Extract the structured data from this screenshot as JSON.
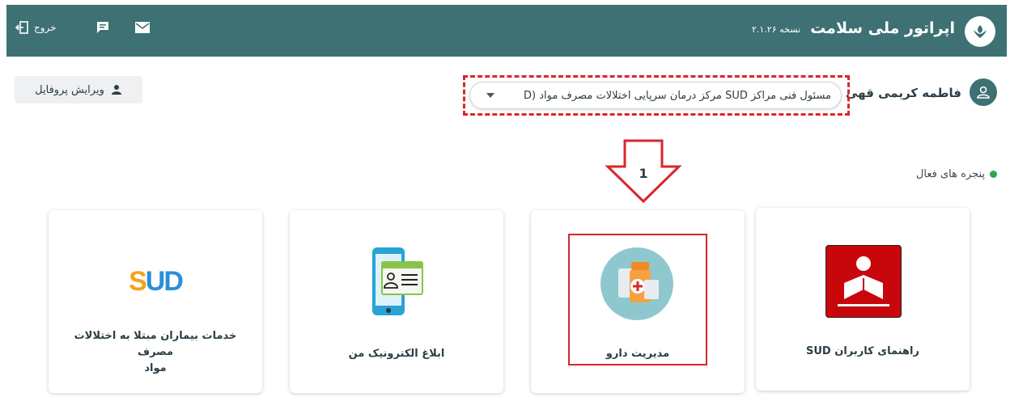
{
  "header": {
    "title": "اپراتور ملی سلامت",
    "version": "نسخه ۲.۱.۲۶",
    "logout_label": "خروج",
    "icons": [
      "brand-logo-icon",
      "message-icon",
      "mail-icon",
      "logout-icon"
    ],
    "bg_color": "#3d7173"
  },
  "user": {
    "name": "فاطمه کریمی قهی",
    "role": "مسئول فنی مراکز SUD مرکز درمان سرپایی اختلالات مصرف مواد (D",
    "edit_profile_label": "ویرایش پروفایل"
  },
  "annotation": {
    "step_number": "1",
    "accent_color": "#d9262b"
  },
  "active_windows_label": "پنجره های فعال",
  "cards": [
    {
      "label": "راهنمای کاربران SUD",
      "icon": "reading-person-icon"
    },
    {
      "label": "مدیریت دارو",
      "icon": "medicine-icon"
    },
    {
      "label": "ابلاغ الکترونیک من",
      "icon": "phone-contact-icon"
    },
    {
      "label_line1": "خدمات بیماران مبتلا به اختلالات مصرف",
      "label_line2": "مواد",
      "logo_text": "SUD",
      "icon": "sud-logo"
    }
  ]
}
